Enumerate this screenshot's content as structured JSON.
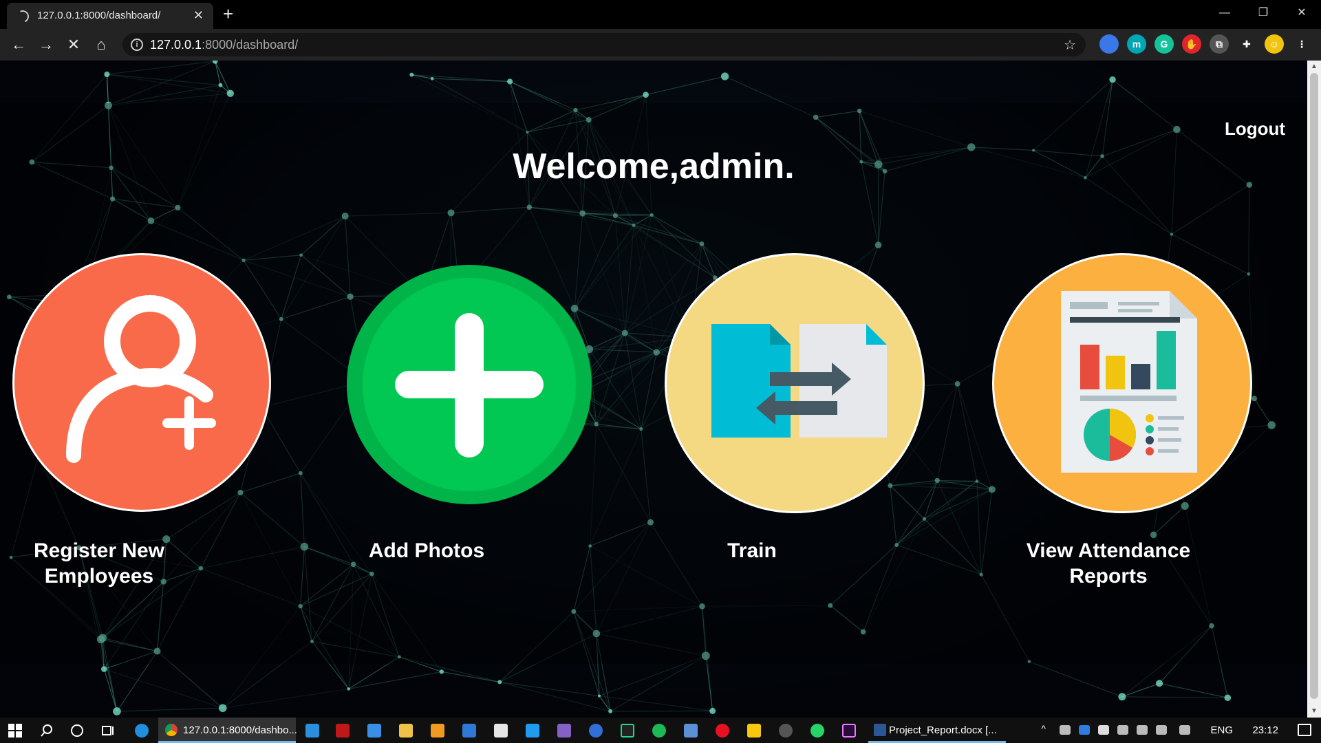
{
  "browser": {
    "tab_title": "127.0.0.1:8000/dashboard/",
    "tab_close": "✕",
    "new_tab": "+",
    "url_host": "127.0.0.1",
    "url_rest": ":8000/dashboard/",
    "extensions": [
      {
        "name": "extension-blue-icon",
        "color": "#3b78e7",
        "glyph": ""
      },
      {
        "name": "extension-m-icon",
        "color": "#00a6b3",
        "glyph": "m"
      },
      {
        "name": "grammarly-icon",
        "color": "#15c39a",
        "glyph": "G"
      },
      {
        "name": "extension-red-icon",
        "color": "#e0262b",
        "glyph": "✋"
      },
      {
        "name": "extension-copy-icon",
        "color": "#555555",
        "glyph": "⧉"
      },
      {
        "name": "extensions-puzzle-icon",
        "color": "#232323",
        "glyph": "✚"
      },
      {
        "name": "profile-avatar-icon",
        "color": "#f1c40f",
        "glyph": "☺"
      },
      {
        "name": "browser-menu-icon",
        "color": "#232323",
        "glyph": "⋮"
      }
    ]
  },
  "page": {
    "logout_label": "Logout",
    "welcome": "Welcome,admin.",
    "tiles": [
      {
        "label_line1": "Register New",
        "label_line2": "Employees"
      },
      {
        "label_line1": "Add Photos",
        "label_line2": ""
      },
      {
        "label_line1": "Train",
        "label_line2": ""
      },
      {
        "label_line1": "View Attendance",
        "label_line2": "Reports"
      }
    ],
    "colors": {
      "register": "#f96a4b",
      "add_photos": "#00c853",
      "train": "#f5d982",
      "reports": "#fbb040"
    }
  },
  "taskbar": {
    "active_app_label": "127.0.0.1:8000/dashbo...",
    "word_label": "Project_Report.docx [...",
    "language": "ENG",
    "time": "23:12"
  }
}
